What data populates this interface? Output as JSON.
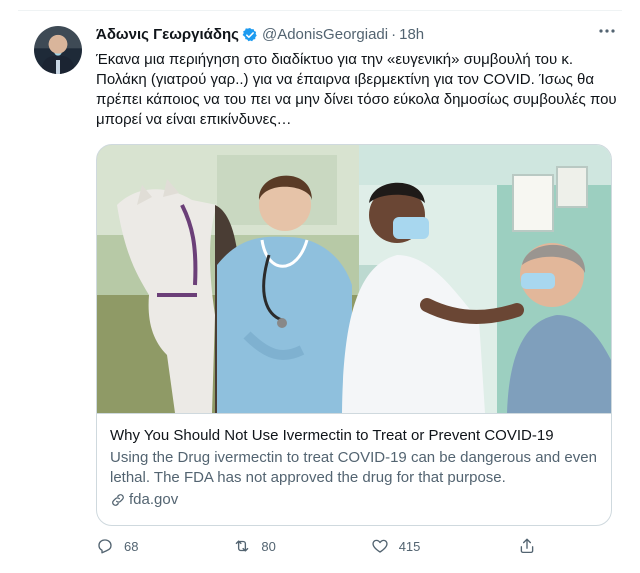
{
  "tweet": {
    "author_name": "Άδωνις Γεωργιάδης",
    "handle": "@AdonisGeorgiadi",
    "separator": "·",
    "time": "18h",
    "more_icon": "more-icon",
    "text": "Έκανα μια περιήγηση στο διαδίκτυο για την «ευγενική» συμβουλή του κ. Πολάκη (γιατρού γαρ..) για να έπαιρνα ιβερμεκτίνη για τον COVID. Ίσως θα πρέπει κάποιος να του πει να μην δίνει τόσο εύκολα δημοσίως συμβουλές που μπορεί να είναι επικίνδυνες…"
  },
  "card": {
    "title": "Why You Should Not Use Ivermectin to Treat or Prevent COVID-19",
    "description": "Using the Drug ivermectin to treat COVID-19 can be dangerous and even lethal. The FDA has not approved the drug for that purpose.",
    "domain": "fda.gov"
  },
  "actions": {
    "replies": "68",
    "retweets": "80",
    "likes": "415"
  },
  "colors": {
    "verified": "#1d9bf0",
    "secondary_text": "#536471",
    "border": "#cfd9de"
  }
}
